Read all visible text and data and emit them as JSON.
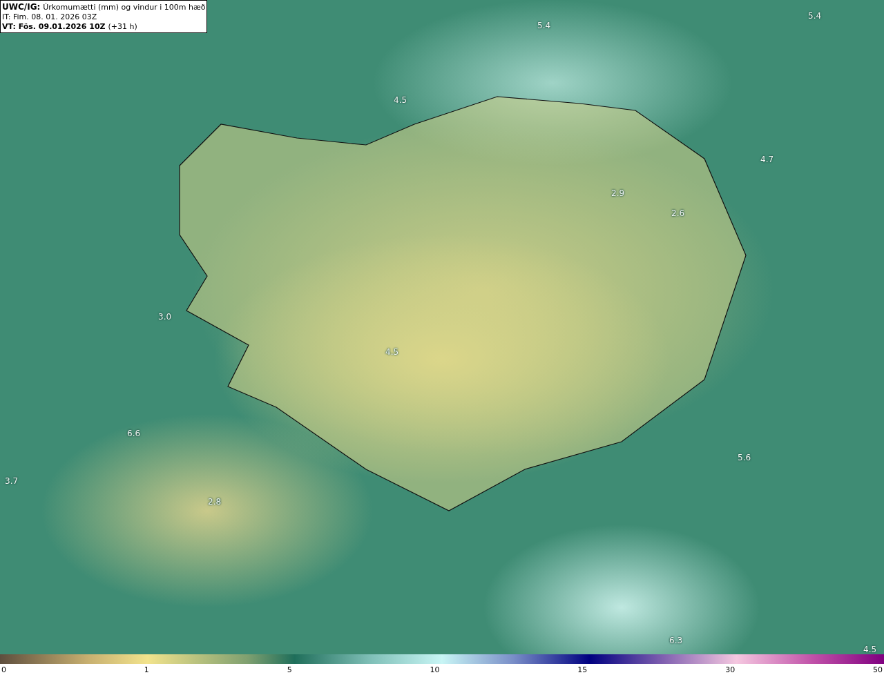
{
  "title_box": {
    "product": "UWC/IG:",
    "title": "Úrkomumætti (mm) og vindur i 100m hæð",
    "initial_time": "IT: Fim. 08. 01. 2026 03Z",
    "valid_time": "VT: Fös. 09.01.2026 10Z",
    "lead": "(+31 h)"
  },
  "map_values": [
    "5.4",
    "5.4",
    "4.5",
    "4.7",
    "2.9",
    "2.6",
    "3.0",
    "4.5",
    "6.6",
    "5.6",
    "3.7",
    "2.8",
    "6.3",
    "4.5"
  ],
  "colorbar": {
    "ticks": [
      "0",
      "1",
      "5",
      "10",
      "15",
      "30",
      "50"
    ]
  }
}
